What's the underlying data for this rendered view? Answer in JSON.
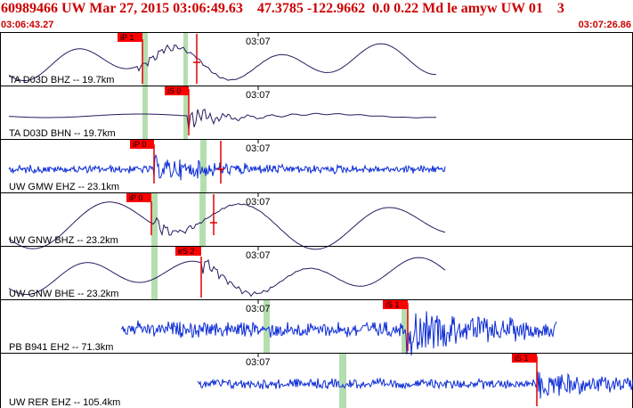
{
  "header": {
    "title": "60989466 UW Mar 27, 2015 03:06:49.63    47.3785 -122.9662  0.0 0.22 Md le amyw UW 01    3",
    "start_time": "03:06:43.27",
    "end_time": "03:07:26.86"
  },
  "colors": {
    "header_text": "#cc0000",
    "trace_dark": "#2a1a5e",
    "trace_blue": "#0b2bd6",
    "pick_flag": "#ff0000",
    "pick_marker": "#e00000",
    "travel_window": "#b5deb0",
    "panel_border": "#000000"
  },
  "traces": [
    {
      "label": "TA D03D BHZ -- 19.7km",
      "tick_label": "03:07",
      "pick_label": "iP 1",
      "style": "dark"
    },
    {
      "label": "TA D03D BHN -- 19.7km",
      "tick_label": "03:07",
      "pick_label": "iS 0",
      "style": "dark"
    },
    {
      "label": "UW GMW EHZ -- 23.1km",
      "tick_label": "03:07",
      "pick_label": "iP 0",
      "style": "blue"
    },
    {
      "label": "UW GNW BHZ -- 23.2km",
      "tick_label": "03:07",
      "pick_label": "iP 0",
      "style": "dark"
    },
    {
      "label": "UW GNW BHE -- 23.2km",
      "tick_label": "03:07",
      "pick_label": "eS 2",
      "style": "dark"
    },
    {
      "label": "PB B941 EH2 -- 71.3km",
      "tick_label": "03:07",
      "pick_label": "iS 1",
      "style": "blue"
    },
    {
      "label": "UW RER EHZ -- 105.4km",
      "tick_label": "03:07",
      "pick_label": "iS 1",
      "style": "blue"
    }
  ]
}
